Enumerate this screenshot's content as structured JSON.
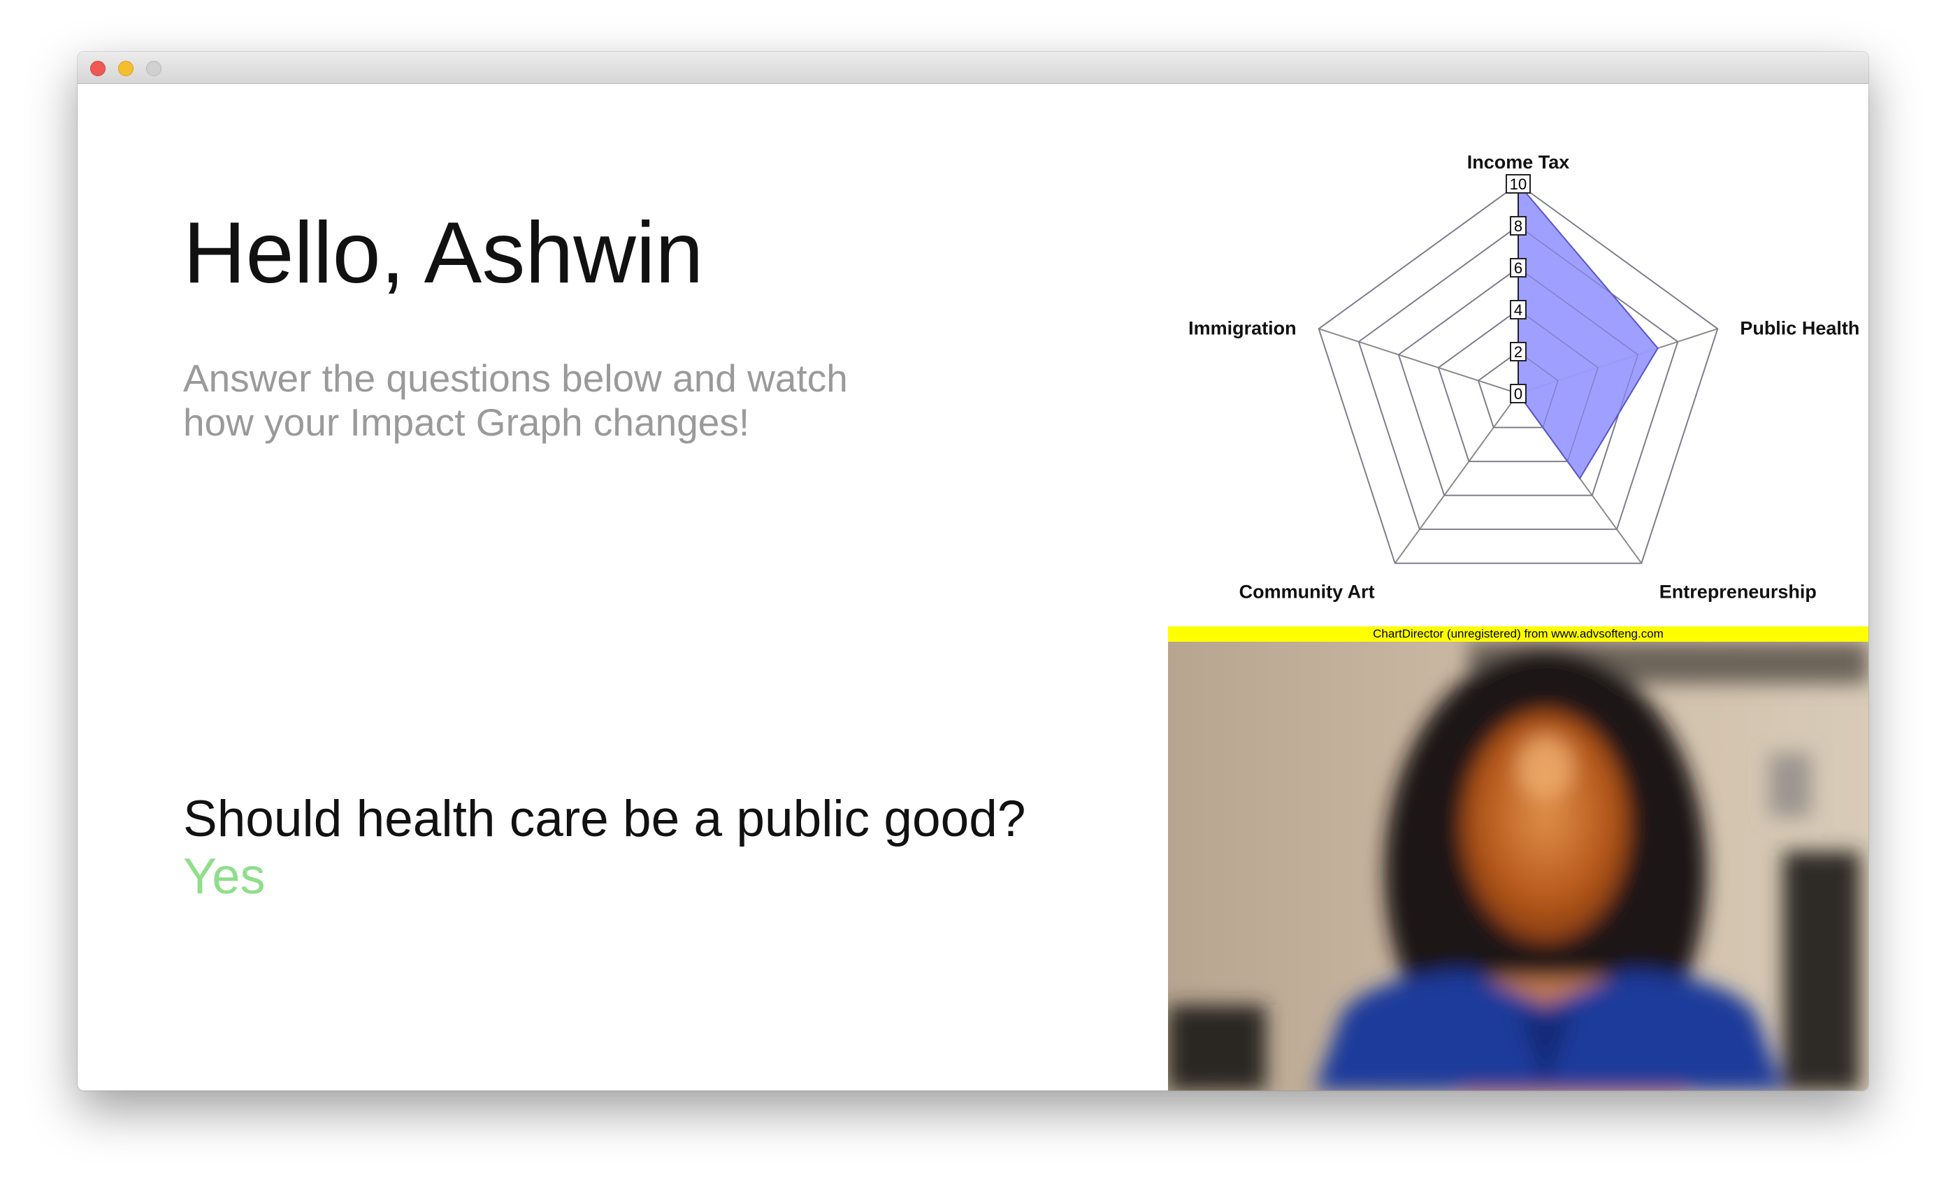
{
  "window": {
    "controls": [
      "close",
      "minimize",
      "zoom"
    ]
  },
  "greeting": "Hello, Ashwin",
  "subtitle": {
    "line1": "Answer the questions below and watch",
    "line2": "how your Impact Graph changes!"
  },
  "question": {
    "text": "Should health care be a public good?",
    "answer": "Yes",
    "answer_color": "#8fde8a"
  },
  "chart_data": {
    "type": "radar",
    "axes": [
      "Income Tax",
      "Public Health",
      "Entrepreneurship",
      "Community Art",
      "Immigration"
    ],
    "values": [
      10,
      7,
      5,
      0,
      0
    ],
    "scale": {
      "min": 0,
      "max": 10,
      "ticks": [
        0,
        2,
        4,
        6,
        8,
        10
      ]
    },
    "fill_color": "#9a9aff",
    "grid": true,
    "watermark": "ChartDirector (unregistered) from www.advsofteng.com"
  },
  "camera": {
    "icon": "webcam-feed"
  }
}
